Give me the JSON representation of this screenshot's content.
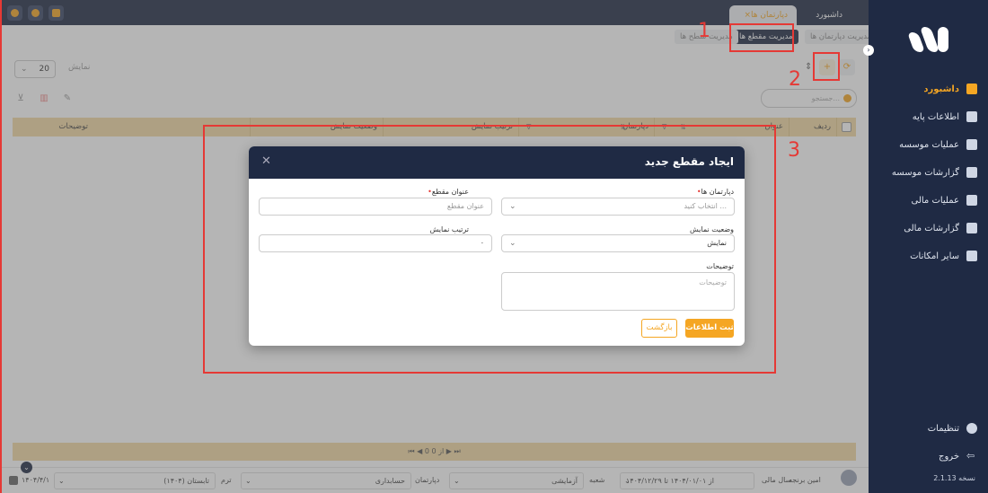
{
  "app": {
    "version": "نسخه 2.1.13"
  },
  "sidebar": {
    "items": [
      {
        "label": "داشبورد",
        "icon": "dashboard-icon",
        "active": true
      },
      {
        "label": "اطلاعات پایه",
        "icon": "layers-icon"
      },
      {
        "label": "عملیات موسسه",
        "icon": "clipboard-icon"
      },
      {
        "label": "گزارشات موسسه",
        "icon": "bar-chart-icon"
      },
      {
        "label": "عملیات مالی",
        "icon": "wallet-icon"
      },
      {
        "label": "گزارشات مالی",
        "icon": "line-chart-icon"
      },
      {
        "label": "سایر امکانات",
        "icon": "more-icon"
      }
    ],
    "settings_label": "تنظیمات",
    "logout_label": "خروج"
  },
  "tabs": [
    {
      "label": "داشبورد"
    },
    {
      "label": "دپارتمان ها"
    }
  ],
  "subtabs": [
    {
      "label": "مدیریت دپارتمان ها"
    },
    {
      "label": "مدیریت مقطع ها"
    },
    {
      "label": "مدیریت سطح ها"
    }
  ],
  "toolbar": {
    "page_size": "20",
    "page_size_label": "نمایش",
    "search_placeholder": "جستجو..."
  },
  "table": {
    "columns": [
      "ردیف",
      "عنوان",
      "دپارتمان",
      "ترتیب نمایش",
      "وضعیت نمایش",
      "توضیحات"
    ]
  },
  "pager": {
    "text": "0 از 0"
  },
  "statusbar": {
    "user": "امین برنجه",
    "fiscal_year_label": "سال مالی",
    "fiscal_year_value": "از ۱۴۰۴/۰۱/۰۱ تا ۱۴۰۴/۱۲/۲۹",
    "branch_label": "شعبه",
    "branch_value": "آزمایشی",
    "department_label": "دپارتمان",
    "department_value": "حسابداری",
    "term_label": "ترم",
    "term_value": "تابستان (۱۴۰۴)",
    "date": "۱۴۰۴/۴/۱"
  },
  "modal": {
    "title": "ایجاد مقطع جدید",
    "fields": {
      "department_label": "دپارتمان ها",
      "department_placeholder": "انتخاب کنید ...",
      "title_label": "عنوان مقطع",
      "title_placeholder": "عنوان مقطع",
      "visibility_label": "وضعیت نمایش",
      "visibility_value": "نمایش",
      "order_label": "ترتیب نمایش",
      "order_value": "۰",
      "description_label": "توضیحات",
      "description_placeholder": "توضیحات"
    },
    "submit_label": "ثبت اطلاعات",
    "back_label": "بازگشت"
  },
  "annotations": [
    "1",
    "2",
    "3"
  ],
  "colors": {
    "primary": "#1f2a44",
    "accent": "#f5a623",
    "annotation": "#e53935"
  }
}
